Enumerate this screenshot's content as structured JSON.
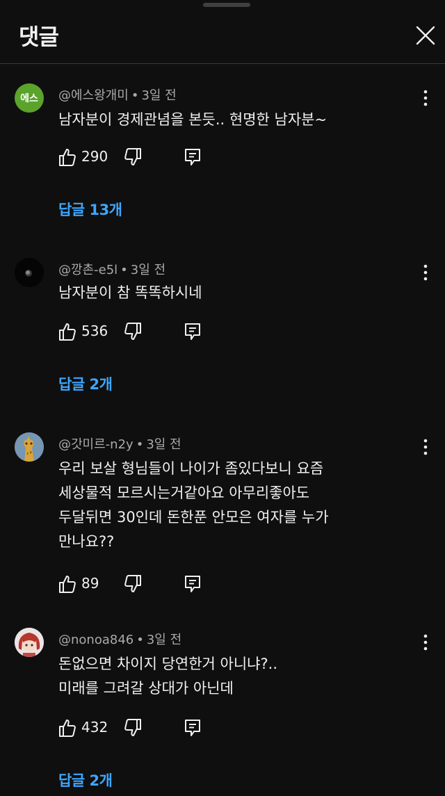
{
  "header": {
    "title": "댓글"
  },
  "comments": [
    {
      "avatar_text": "에스",
      "author": "@에스왕개미",
      "time": "3일 전",
      "lines": [
        "남자분이 경제관념을 본듯.. 현명한 남자분~"
      ],
      "likes": "290",
      "replies_label": "답글 13개"
    },
    {
      "author": "@깡촌-e5l",
      "time": "3일 전",
      "lines": [
        "남자분이 참 똑똑하시네"
      ],
      "likes": "536",
      "replies_label": "답글 2개"
    },
    {
      "author": "@갓미르-n2y",
      "time": "3일 전",
      "lines": [
        "우리 보살 형님들이 나이가 좀있다보니 요즘",
        "세상물적 모르시는거같아요 아무리좋아도",
        "두달뒤면 30인데 돈한푼 안모은 여자를 누가",
        "만나요??"
      ],
      "likes": "89"
    },
    {
      "author": "@nonoa846",
      "time": "3일 전",
      "lines": [
        "돈없으면 차이지 당연한거 아니냐?..",
        "미래를 그려갈 상대가 아닌데"
      ],
      "likes": "432",
      "replies_label": "답글 2개"
    }
  ],
  "colors": {
    "background": "#0f0f0f",
    "link": "#3ea6ff",
    "secondary_text": "#aaaaaa"
  }
}
